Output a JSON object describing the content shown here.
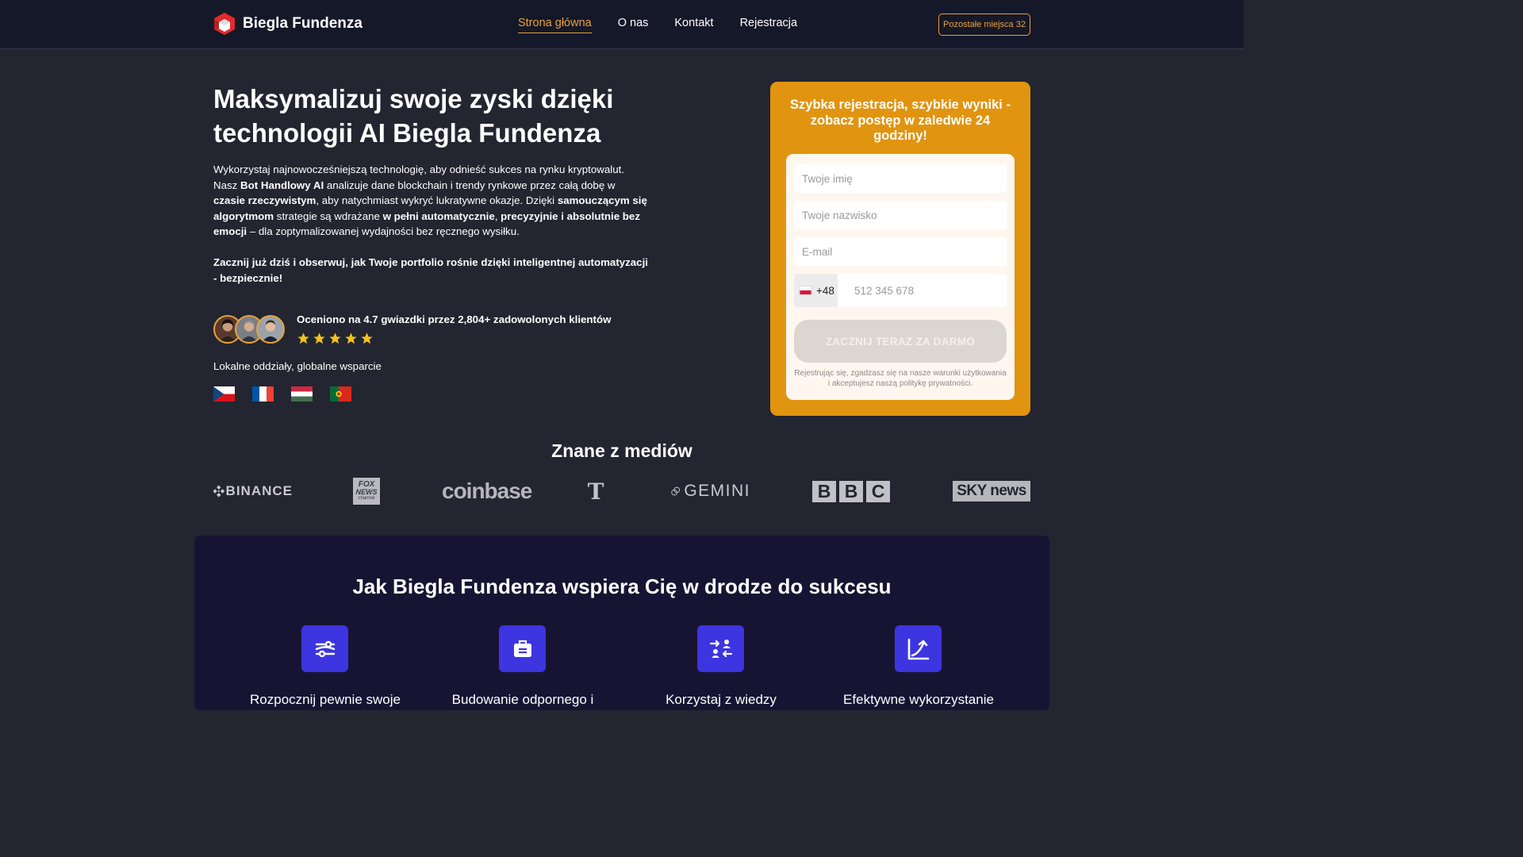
{
  "header": {
    "brand": "Biegla Fundenza",
    "nav": [
      "Strona główna",
      "O nas",
      "Kontakt",
      "Rejestracja"
    ],
    "seats_button": "Pozostałe miejsca 32"
  },
  "hero": {
    "title": "Maksymalizuj swoje zyski dzięki technologii AI Biegla Fundenza",
    "desc": {
      "p1": "Wykorzystaj najnowocześniejszą technologię, aby odnieść sukces na rynku kryptowalut. Nasz ",
      "b1": "Bot Handlowy AI",
      "p2": " analizuje dane blockchain i trendy rynkowe przez całą dobę w ",
      "b2": "czasie rzeczywistym",
      "p3": ", aby natychmiast wykryć lukratywne okazje. Dzięki ",
      "b3": "samouczącym się algorytmom",
      "p4": " strategie są wdrażane ",
      "b4": "w pełni automatycznie",
      "p5": ", ",
      "b5": "precyzyjnie i absolutnie bez emocji",
      "p6": " – dla zoptymalizowanej wydajności bez ręcznego wysiłku."
    },
    "cta": "Zacznij już dziś i obserwuj, jak Twoje portfolio rośnie dzięki inteligentnej automatyzacji - bezpiecznie!",
    "rating": "Oceniono na 4.7 gwiazdki przez 2,804+ zadowolonych klientów",
    "rating_stars": 5,
    "branches": "Lokalne oddziały, globalne wsparcie"
  },
  "signup": {
    "title": "Szybka rejestracja, szybkie wyniki - zobacz postęp w zaledwie 24 godziny!",
    "first_name_placeholder": "Twoje imię",
    "last_name_placeholder": "Twoje nazwisko",
    "email_placeholder": "E-mail",
    "phone_prefix": "+48",
    "phone_placeholder": "512 345 678",
    "submit": "ZACZNIJ TERAZ ZA DARMO",
    "terms": "Rejestrując się, zgadzasz się na nasze warunki użytkowania i akceptujesz naszą politykę prywatności."
  },
  "media": {
    "title": "Znane z mediów",
    "logos": {
      "binance": "BINANCE",
      "fox_top": "FOX",
      "fox_mid": "NEWS",
      "fox_bottom": "channel",
      "coinbase": "coinbase",
      "nyt": "T",
      "gemini": "GEMINI",
      "bbc": [
        "B",
        "B",
        "C"
      ],
      "sky": "SKY news"
    }
  },
  "support": {
    "title": "Jak Biegla Fundenza wspiera Cię w drodze do sukcesu",
    "features": [
      {
        "label": "Rozpocznij pewnie swoje"
      },
      {
        "label": "Budowanie odpornego i"
      },
      {
        "label": "Korzystaj z wiedzy"
      },
      {
        "label": "Efektywne wykorzystanie"
      }
    ]
  },
  "colors": {
    "accent": "#e8a13a",
    "card": "#e19410",
    "header_bg": "#151828",
    "page_bg": "#232530",
    "support_bg": "#171433",
    "feature_icon": "#3c35e0",
    "star": "#f5c21b"
  },
  "icons": {
    "logo": "hexagon-cube-logo",
    "star": "star-icon",
    "features": [
      "sliders-icon",
      "briefcase-icon",
      "exchange-users-icon",
      "growth-curve-icon"
    ]
  }
}
